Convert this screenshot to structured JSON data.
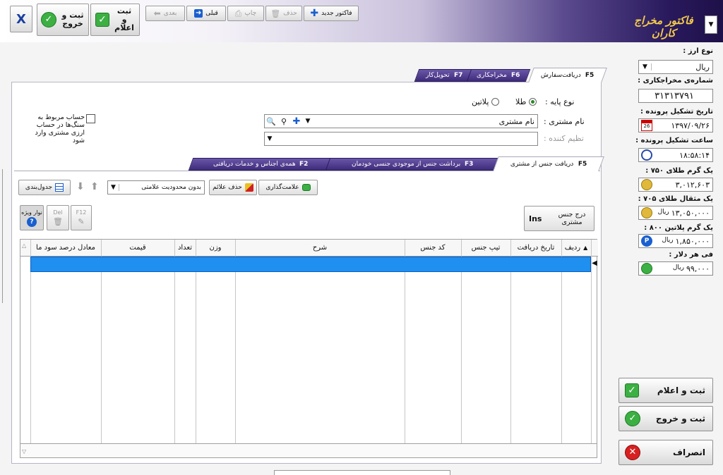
{
  "header": {
    "logo": "فاکتور مخراج کاران",
    "new_invoice": "فاکتور جدید",
    "delete": "حذف",
    "print": "چاپ",
    "prev": "قبلی",
    "next": "بعدی",
    "save_notify": "ثبت و اعلام",
    "save_exit": "ثبت و خروج",
    "close": "X"
  },
  "sidebar": {
    "currency_label": "نوع ارز :",
    "currency_value": "ریال",
    "job_no_label": "شماره‌ی مخراجکاری :",
    "job_no_value": "۳۱۳۱۳۷۹۱",
    "file_date_label": "تاریخ تشکیل پرونده :",
    "file_date_value": "۱۳۹۷/۰۹/۲۶",
    "cal_day": "26",
    "file_time_label": "ساعت تشکیل پرونده :",
    "file_time_value": "۱۸:۵۸:۱۴",
    "gold750_label": "یک گرم طلای ۷۵۰ :",
    "gold750_value": "۳,۰۱۲,۶۰۳",
    "gold705_label": "یک مثقال طلای ۷۰۵ :",
    "gold705_value": "۱۳,۰۵۰,۰۰۰",
    "platinum_label": "یک گرم پلاتین ۸۰۰ :",
    "platinum_value": "۱,۸۵۰,۰۰۰",
    "dollar_label": "فی هر دلار :",
    "dollar_value": "۹۹,۰۰۰",
    "unit": "ریال",
    "platinum_icon_letter": "P"
  },
  "tabs": [
    {
      "label": "دریافت‌سفارش",
      "key": "F5"
    },
    {
      "label": "مخراجکاری",
      "key": "F6"
    },
    {
      "label": "تحویل‌کار",
      "key": "F7"
    }
  ],
  "form": {
    "base_type_label": "نوع پایه :",
    "gold": "طلا",
    "platinum": "پلاتین",
    "customer_label": "نام مشتری :",
    "customer_value": "نام مشتری",
    "adjuster_label": "تظیم کننده :",
    "checkbox_label": "حساب مربوط به سنگ‌ها در حساب ارزی مشتری وارد شود"
  },
  "subtabs": [
    {
      "label": "دریافت جنس از مشتری",
      "key": "F5"
    },
    {
      "label": "برداشت جنس از موجودی جنسی خودمان",
      "key": "F3"
    },
    {
      "label": "همه‌ی اجناس و خدمات دریافتی",
      "key": "F2"
    }
  ],
  "toolbar": {
    "mark": "علامت‌گذاری",
    "remove_marks": "حذف علائم",
    "filter_value": "بدون محدودیت علامتی",
    "table_settings": "جدول‌بندی",
    "insert_customer_item": "درج جنس مشتری",
    "ins_key": "Ins",
    "f12": "F12",
    "del": "Del",
    "special_bar": "نوار ویژه"
  },
  "table": {
    "columns": [
      "ردیف",
      "تاریخ دریافت",
      "تیپ جنس",
      "کد جنس",
      "شرح",
      "وزن",
      "تعداد",
      "قیمت",
      "معادل درصد سود ما"
    ]
  },
  "footer": {
    "save_notify": "ثبت و اعلام",
    "save_exit": "ثبت و خروج",
    "cancel": "انصراف"
  }
}
